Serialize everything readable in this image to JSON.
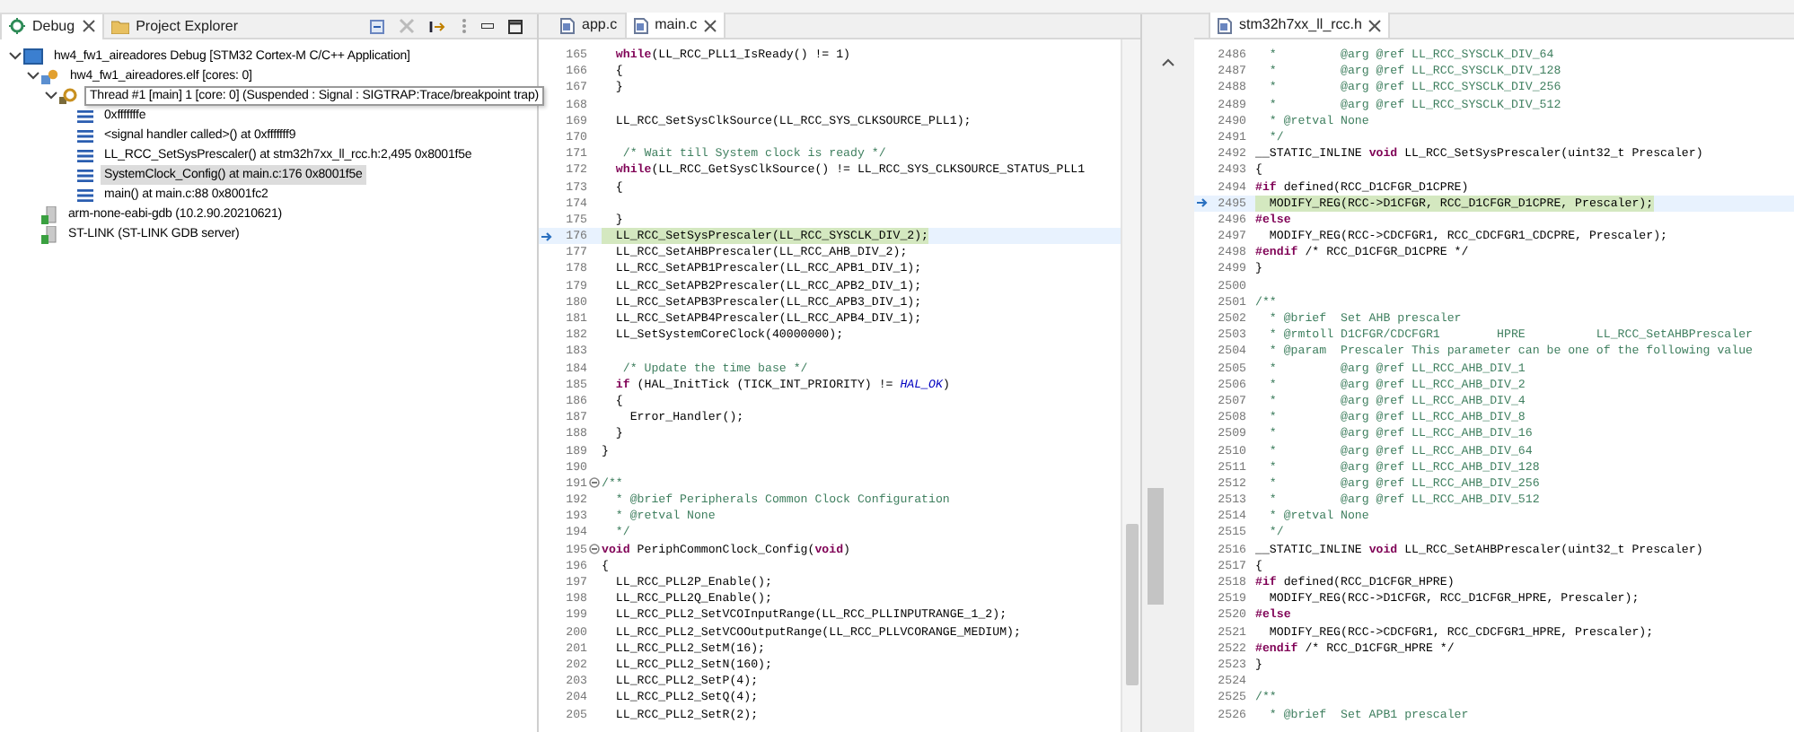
{
  "debug_panel": {
    "tabs": [
      {
        "label": "Debug",
        "selected": true,
        "kind": "debug"
      },
      {
        "label": "Project Explorer",
        "selected": false,
        "kind": "project"
      }
    ],
    "tree": [
      {
        "label": "hw4_fw1_aireadores Debug [STM32 Cortex-M C/C++ Application]",
        "kind": "launch",
        "expanded": true,
        "selected": false,
        "outlined": false,
        "children": [
          {
            "label": "hw4_fw1_aireadores.elf [cores: 0]",
            "kind": "process",
            "expanded": true,
            "selected": false,
            "outlined": false,
            "children": [
              {
                "label": "Thread #1 [main] 1 [core: 0] (Suspended : Signal : SIGTRAP:Trace/breakpoint trap)",
                "kind": "thread",
                "expanded": true,
                "selected": false,
                "outlined": true,
                "children": [
                  {
                    "label": "0xfffffffe",
                    "kind": "frame",
                    "selected": false,
                    "outlined": false
                  },
                  {
                    "label": "<signal handler called>() at 0xfffffff9",
                    "kind": "frame",
                    "selected": false,
                    "outlined": false
                  },
                  {
                    "label": "LL_RCC_SetSysPrescaler() at stm32h7xx_ll_rcc.h:2,495 0x8001f5e",
                    "kind": "frame",
                    "selected": false,
                    "outlined": false
                  },
                  {
                    "label": "SystemClock_Config() at main.c:176 0x8001f5e",
                    "kind": "frame",
                    "selected": true,
                    "outlined": false
                  },
                  {
                    "label": "main() at main.c:88 0x8001fc2",
                    "kind": "frame",
                    "selected": false,
                    "outlined": false
                  }
                ]
              }
            ]
          },
          {
            "label": "arm-none-eabi-gdb (10.2.90.20210621)",
            "kind": "gdb",
            "selected": false,
            "outlined": false
          },
          {
            "label": "ST-LINK (ST-LINK GDB server)",
            "kind": "gdb",
            "selected": false,
            "outlined": false
          }
        ]
      }
    ]
  },
  "editors": [
    {
      "tabs": [
        {
          "label": "app.c",
          "selected": false
        },
        {
          "label": "main.c",
          "selected": true
        }
      ],
      "lines": [
        {
          "num": "165",
          "text": "  **while**(LL_RCC_PLL1_IsReady() != 1)",
          "kind": "code",
          "current": false,
          "fold": false
        },
        {
          "num": "166",
          "text": "  {",
          "kind": "code",
          "current": false,
          "fold": false
        },
        {
          "num": "167",
          "text": "  }",
          "kind": "code",
          "current": false,
          "fold": false
        },
        {
          "num": "168",
          "current": false,
          "fold": false
        },
        {
          "num": "169",
          "text": "  LL_RCC_SetSysClkSource(LL_RCC_SYS_CLKSOURCE_PLL1);",
          "kind": "code",
          "current": false,
          "fold": false
        },
        {
          "num": "170",
          "current": false,
          "fold": false
        },
        {
          "num": "171",
          "text": "   /* Wait till System clock is ready */",
          "kind": "comment",
          "current": false,
          "fold": false
        },
        {
          "num": "172",
          "text": "  **while**(LL_RCC_GetSysClkSource() != LL_RCC_SYS_CLKSOURCE_STATUS_PLL1",
          "kind": "code",
          "current": false,
          "fold": false
        },
        {
          "num": "173",
          "text": "  {",
          "kind": "code",
          "current": false,
          "fold": false
        },
        {
          "num": "174",
          "current": false,
          "fold": false
        },
        {
          "num": "175",
          "text": "  }",
          "kind": "code",
          "current": false,
          "fold": false
        },
        {
          "num": "176",
          "text": "  LL_RCC_SetSysPrescaler(LL_RCC_SYSCLK_DIV_2);",
          "kind": "code",
          "current": true,
          "fold": false
        },
        {
          "num": "177",
          "text": "  LL_RCC_SetAHBPrescaler(LL_RCC_AHB_DIV_2);",
          "kind": "code",
          "current": false,
          "fold": false
        },
        {
          "num": "178",
          "text": "  LL_RCC_SetAPB1Prescaler(LL_RCC_APB1_DIV_1);",
          "kind": "code",
          "current": false,
          "fold": false
        },
        {
          "num": "179",
          "text": "  LL_RCC_SetAPB2Prescaler(LL_RCC_APB2_DIV_1);",
          "kind": "code",
          "current": false,
          "fold": false
        },
        {
          "num": "180",
          "text": "  LL_RCC_SetAPB3Prescaler(LL_RCC_APB3_DIV_1);",
          "kind": "code",
          "current": false,
          "fold": false
        },
        {
          "num": "181",
          "text": "  LL_RCC_SetAPB4Prescaler(LL_RCC_APB4_DIV_1);",
          "kind": "code",
          "current": false,
          "fold": false
        },
        {
          "num": "182",
          "text": "  LL_SetSystemCoreClock(40000000);",
          "kind": "code",
          "current": false,
          "fold": false
        },
        {
          "num": "183",
          "current": false,
          "fold": false
        },
        {
          "num": "184",
          "text": "   /* Update the time base */",
          "kind": "comment",
          "current": false,
          "fold": false
        },
        {
          "num": "185",
          "text": "  **if** (HAL_InitTick (TICK_INT_PRIORITY) != *HAL_OK*)",
          "kind": "code",
          "current": false,
          "fold": false
        },
        {
          "num": "186",
          "text": "  {",
          "kind": "code",
          "current": false,
          "fold": false
        },
        {
          "num": "187",
          "text": "    Error_Handler();",
          "kind": "code",
          "current": false,
          "fold": false
        },
        {
          "num": "188",
          "text": "  }",
          "kind": "code",
          "current": false,
          "fold": false
        },
        {
          "num": "189",
          "text": "}",
          "kind": "code",
          "current": false,
          "fold": false
        },
        {
          "num": "190",
          "current": false,
          "fold": false
        },
        {
          "num": "191",
          "text": "/**",
          "kind": "comment",
          "current": false,
          "fold": true
        },
        {
          "num": "192",
          "text": "  * @brief Peripherals Common Clock Configuration",
          "kind": "comment",
          "current": false,
          "fold": false
        },
        {
          "num": "193",
          "text": "  * @retval None",
          "kind": "comment",
          "current": false,
          "fold": false
        },
        {
          "num": "194",
          "text": "  */",
          "kind": "comment",
          "current": false,
          "fold": false
        },
        {
          "num": "195",
          "text": "**void** PeriphCommonClock_Config(**void**)",
          "kind": "code",
          "current": false,
          "fold": true
        },
        {
          "num": "196",
          "text": "{",
          "kind": "code",
          "current": false,
          "fold": false
        },
        {
          "num": "197",
          "text": "  LL_RCC_PLL2P_Enable();",
          "kind": "code",
          "current": false,
          "fold": false
        },
        {
          "num": "198",
          "text": "  LL_RCC_PLL2Q_Enable();",
          "kind": "code",
          "current": false,
          "fold": false
        },
        {
          "num": "199",
          "text": "  LL_RCC_PLL2_SetVCOInputRange(LL_RCC_PLLINPUTRANGE_1_2);",
          "kind": "code",
          "current": false,
          "fold": false
        },
        {
          "num": "200",
          "text": "  LL_RCC_PLL2_SetVCOOutputRange(LL_RCC_PLLVCORANGE_MEDIUM);",
          "kind": "code",
          "current": false,
          "fold": false
        },
        {
          "num": "201",
          "text": "  LL_RCC_PLL2_SetM(16);",
          "kind": "code",
          "current": false,
          "fold": false
        },
        {
          "num": "202",
          "text": "  LL_RCC_PLL2_SetN(160);",
          "kind": "code",
          "current": false,
          "fold": false
        },
        {
          "num": "203",
          "text": "  LL_RCC_PLL2_SetP(4);",
          "kind": "code",
          "current": false,
          "fold": false
        },
        {
          "num": "204",
          "text": "  LL_RCC_PLL2_SetQ(4);",
          "kind": "code",
          "current": false,
          "fold": false
        },
        {
          "num": "205",
          "text": "  LL_RCC_PLL2_SetR(2);",
          "kind": "code",
          "current": false,
          "fold": false
        }
      ]
    },
    {
      "tabs": [
        {
          "label": "stm32h7xx_ll_rcc.h",
          "selected": true
        }
      ],
      "lines": [
        {
          "num": "2486",
          "text": "  *         @arg @ref LL_RCC_SYSCLK_DIV_64",
          "kind": "comment",
          "current": false,
          "fold": false
        },
        {
          "num": "2487",
          "text": "  *         @arg @ref LL_RCC_SYSCLK_DIV_128",
          "kind": "comment",
          "current": false,
          "fold": false
        },
        {
          "num": "2488",
          "text": "  *         @arg @ref LL_RCC_SYSCLK_DIV_256",
          "kind": "comment",
          "current": false,
          "fold": false
        },
        {
          "num": "2489",
          "text": "  *         @arg @ref LL_RCC_SYSCLK_DIV_512",
          "kind": "comment",
          "current": false,
          "fold": false
        },
        {
          "num": "2490",
          "text": "  * @retval None",
          "kind": "comment",
          "current": false,
          "fold": false
        },
        {
          "num": "2491",
          "text": "  */",
          "kind": "comment",
          "current": false,
          "fold": false
        },
        {
          "num": "2492",
          "text": "__STATIC_INLINE **void** LL_RCC_SetSysPrescaler(uint32_t Prescaler)",
          "kind": "code",
          "current": false,
          "fold": false
        },
        {
          "num": "2493",
          "text": "{",
          "kind": "code",
          "current": false,
          "fold": false
        },
        {
          "num": "2494",
          "text": "**#if** defined(RCC_D1CFGR_D1CPRE)",
          "kind": "code",
          "current": false,
          "fold": false
        },
        {
          "num": "2495",
          "text": "  MODIFY_REG(RCC->D1CFGR, RCC_D1CFGR_D1CPRE, Prescaler);",
          "kind": "code",
          "current": true,
          "fold": false
        },
        {
          "num": "2496",
          "text": "**#else**",
          "kind": "code",
          "current": false,
          "fold": false
        },
        {
          "num": "2497",
          "text": "  MODIFY_REG(RCC->CDCFGR1, RCC_CDCFGR1_CDCPRE, Prescaler);",
          "kind": "code",
          "current": false,
          "fold": false
        },
        {
          "num": "2498",
          "text": "**#endif** /* RCC_D1CFGR_D1CPRE */",
          "kind": "code",
          "current": false,
          "fold": false
        },
        {
          "num": "2499",
          "text": "}",
          "kind": "code",
          "current": false,
          "fold": false
        },
        {
          "num": "2500",
          "current": false,
          "fold": false
        },
        {
          "num": "2501",
          "text": "/**",
          "kind": "comment",
          "current": false,
          "fold": false
        },
        {
          "num": "2502",
          "text": "  * @brief  Set AHB prescaler",
          "kind": "comment",
          "current": false,
          "fold": false
        },
        {
          "num": "2503",
          "text": "  * @rmtoll D1CFGR/CDCFGR1        HPRE          LL_RCC_SetAHBPrescaler",
          "kind": "comment",
          "current": false,
          "fold": false
        },
        {
          "num": "2504",
          "text": "  * @param  Prescaler This parameter can be one of the following value",
          "kind": "comment",
          "current": false,
          "fold": false
        },
        {
          "num": "2505",
          "text": "  *         @arg @ref LL_RCC_AHB_DIV_1",
          "kind": "comment",
          "current": false,
          "fold": false
        },
        {
          "num": "2506",
          "text": "  *         @arg @ref LL_RCC_AHB_DIV_2",
          "kind": "comment",
          "current": false,
          "fold": false
        },
        {
          "num": "2507",
          "text": "  *         @arg @ref LL_RCC_AHB_DIV_4",
          "kind": "comment",
          "current": false,
          "fold": false
        },
        {
          "num": "2508",
          "text": "  *         @arg @ref LL_RCC_AHB_DIV_8",
          "kind": "comment",
          "current": false,
          "fold": false
        },
        {
          "num": "2509",
          "text": "  *         @arg @ref LL_RCC_AHB_DIV_16",
          "kind": "comment",
          "current": false,
          "fold": false
        },
        {
          "num": "2510",
          "text": "  *         @arg @ref LL_RCC_AHB_DIV_64",
          "kind": "comment",
          "current": false,
          "fold": false
        },
        {
          "num": "2511",
          "text": "  *         @arg @ref LL_RCC_AHB_DIV_128",
          "kind": "comment",
          "current": false,
          "fold": false
        },
        {
          "num": "2512",
          "text": "  *         @arg @ref LL_RCC_AHB_DIV_256",
          "kind": "comment",
          "current": false,
          "fold": false
        },
        {
          "num": "2513",
          "text": "  *         @arg @ref LL_RCC_AHB_DIV_512",
          "kind": "comment",
          "current": false,
          "fold": false
        },
        {
          "num": "2514",
          "text": "  * @retval None",
          "kind": "comment",
          "current": false,
          "fold": false
        },
        {
          "num": "2515",
          "text": "  */",
          "kind": "comment",
          "current": false,
          "fold": false
        },
        {
          "num": "2516",
          "text": "__STATIC_INLINE **void** LL_RCC_SetAHBPrescaler(uint32_t Prescaler)",
          "kind": "code",
          "current": false,
          "fold": false
        },
        {
          "num": "2517",
          "text": "{",
          "kind": "code",
          "current": false,
          "fold": false
        },
        {
          "num": "2518",
          "text": "**#if** defined(RCC_D1CFGR_HPRE)",
          "kind": "code",
          "current": false,
          "fold": false
        },
        {
          "num": "2519",
          "text": "  MODIFY_REG(RCC->D1CFGR, RCC_D1CFGR_HPRE, Prescaler);",
          "kind": "code",
          "current": false,
          "fold": false
        },
        {
          "num": "2520",
          "text": "**#else**",
          "kind": "code",
          "current": false,
          "fold": false
        },
        {
          "num": "2521",
          "text": "  MODIFY_REG(RCC->CDCFGR1, RCC_CDCFGR1_HPRE, Prescaler);",
          "kind": "code",
          "current": false,
          "fold": false
        },
        {
          "num": "2522",
          "text": "**#endif** /* RCC_D1CFGR_HPRE */",
          "kind": "code",
          "current": false,
          "fold": false
        },
        {
          "num": "2523",
          "text": "}",
          "kind": "code",
          "current": false,
          "fold": false
        },
        {
          "num": "2524",
          "current": false,
          "fold": false
        },
        {
          "num": "2525",
          "text": "/**",
          "kind": "comment",
          "current": false,
          "fold": false
        },
        {
          "num": "2526",
          "text": "  * @brief  Set APB1 prescaler",
          "kind": "comment",
          "current": false,
          "fold": false
        }
      ]
    }
  ]
}
